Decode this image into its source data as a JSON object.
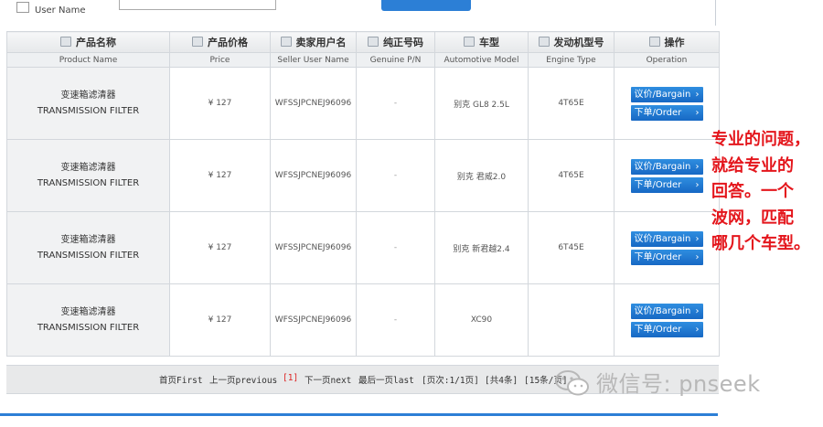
{
  "top": {
    "username_label": "User Name"
  },
  "table": {
    "headers_cn": [
      "产品名称",
      "产品价格",
      "卖家用户名",
      "纯正号码",
      "车型",
      "发动机型号",
      "操作"
    ],
    "headers_en": [
      "Product Name",
      "Price",
      "Seller User Name",
      "Genuine P/N",
      "Automotive Model",
      "Engine Type",
      "Operation"
    ],
    "rows": [
      {
        "name_cn": "变速箱滤清器",
        "name_en": "TRANSMISSION FILTER",
        "price": "¥ 127",
        "seller": "WFSSJPCNEJ96096",
        "pn": "-",
        "model": "别克 GL8 2.5L",
        "engine": "4T65E"
      },
      {
        "name_cn": "变速箱滤清器",
        "name_en": "TRANSMISSION FILTER",
        "price": "¥ 127",
        "seller": "WFSSJPCNEJ96096",
        "pn": "-",
        "model": "别克 君威2.0",
        "engine": "4T65E"
      },
      {
        "name_cn": "变速箱滤清器",
        "name_en": "TRANSMISSION FILTER",
        "price": "¥ 127",
        "seller": "WFSSJPCNEJ96096",
        "pn": "-",
        "model": "别克 新君越2.4",
        "engine": "6T45E"
      },
      {
        "name_cn": "变速箱滤清器",
        "name_en": "TRANSMISSION FILTER",
        "price": "¥ 127",
        "seller": "WFSSJPCNEJ96096",
        "pn": "-",
        "model": "XC90",
        "engine": ""
      }
    ],
    "bargain_label": "议价/Bargain",
    "order_label": "下单/Order"
  },
  "pager": {
    "first": "首页First",
    "prev": "上一页previous",
    "current": "[1]",
    "next": "下一页next",
    "last": "最后一页last",
    "pages": "[页次:1/1页]",
    "count": "[共4条]",
    "per_page": "[15条/页]"
  },
  "note_lines": [
    "专业的问题，",
    "就给专业的",
    "回答。一个",
    "波网，匹配",
    "哪几个车型。"
  ],
  "watermark": {
    "text": "微信号: pnseek",
    "icon": "wechat-icon"
  }
}
